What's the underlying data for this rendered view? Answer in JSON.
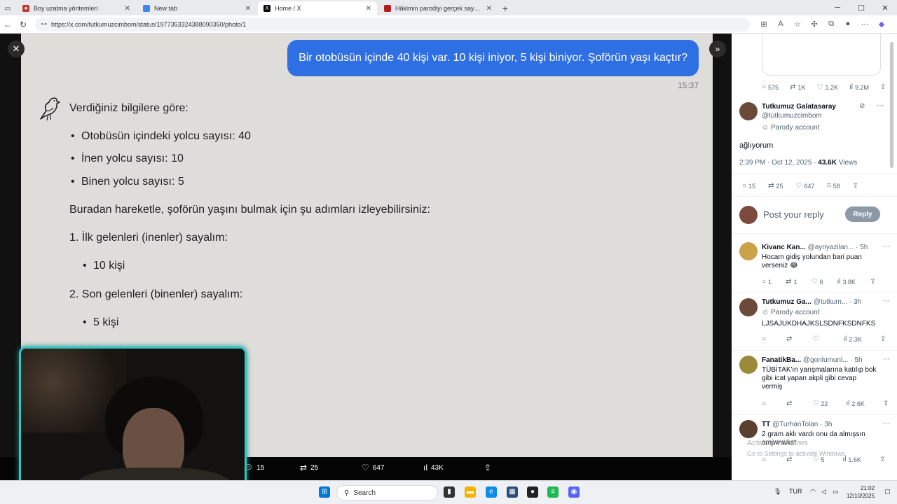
{
  "browser": {
    "tabs": [
      {
        "title": "Boy uzatma yöntemleri",
        "favicon_color": "#c0392b"
      },
      {
        "title": "New tab",
        "favicon_color": "#4285f4"
      },
      {
        "title": "Home / X",
        "favicon_color": "#000000"
      },
      {
        "title": "Hâkimin parodiyi gerçek sayarak",
        "favicon_color": "#b71c1c"
      }
    ],
    "url": "https://x.com/tutkumuzcimbom/status/1977353324388090350/photo/1"
  },
  "chat": {
    "user_message": "Bir otobüsün içinde 40 kişi var. 10 kişi iniyor, 5 kişi biniyor. Şoförün yaşı kaçtır?",
    "time": "15:37",
    "intro": "Verdiğiniz bilgilere göre:",
    "bullets": [
      "Otobüsün içindeki yolcu sayısı: 40",
      "İnen yolcu sayısı: 10",
      "Binen yolcu sayısı: 5"
    ],
    "step_intro": "Buradan hareketle, şoförün yaşını bulmak için şu adımları izleyebilirsiniz:",
    "step1": "1. İlk gelenleri (inenler) sayalım:",
    "step1_item": "10 kişi",
    "step2": "2. Son gelenleri (binenler) sayalım:",
    "step2_item": "5 kişi"
  },
  "viewer_actions": {
    "replies": "15",
    "reposts": "25",
    "likes": "647",
    "views": "43K"
  },
  "sidebar": {
    "top_stats": {
      "replies": "575",
      "reposts": "1K",
      "likes": "1.2K",
      "views": "9.2M"
    },
    "post": {
      "name": "Tutkumuz Galatasaray",
      "handle": "@tutkumuzcimbom",
      "parody": "Parody account",
      "text": "ağlıyorum",
      "meta": "2:39 PM · Oct 12, 2025 ·",
      "views_count": "43.6K",
      "views_label": "Views",
      "stats": {
        "replies": "15",
        "reposts": "25",
        "likes": "647",
        "bookmarks": "58"
      }
    },
    "reply_placeholder": "Post your reply",
    "reply_button": "Reply",
    "replies": [
      {
        "name": "Kivanc Kan...",
        "handle": "@ayriyazilan...",
        "time": "· 5h",
        "text": "Hocam gidiş yolundan bari puan verseniz 😂",
        "replies": "1",
        "reposts": "1",
        "likes": "6",
        "views": "3.8K"
      },
      {
        "name": "Tutkumuz Ga...",
        "handle": "@tutkum...",
        "time": "· 3h",
        "parody": "Parody account",
        "text": "LJSAJUKDHAJKSLSDNFKSDNFKS",
        "replies": "",
        "reposts": "",
        "likes": "",
        "views": "2.3K"
      },
      {
        "name": "FanatikBa...",
        "handle": "@gonlumunl...",
        "time": "· 5h",
        "text": "TÜBİTAK'ın yarışmalarına katılıp bok gibi icat yapan akpli gibi cevap vermiş",
        "replies": "",
        "reposts": "",
        "likes": "22",
        "views": "2.6K"
      },
      {
        "name": "TT",
        "handle": "@TurhanTolan",
        "time": "· 3h",
        "text": "2 gram aklı vardı onu da almışsın amjwnwkst",
        "replies": "",
        "reposts": "",
        "likes": "5",
        "views": "1.6K"
      }
    ],
    "watermark_title": "Activate Windows",
    "watermark_sub": "Go to Settings to activate Windows."
  },
  "taskbar": {
    "search_placeholder": "Search",
    "lang": "TUR",
    "time": "21:02",
    "date": "12/10/2025"
  }
}
